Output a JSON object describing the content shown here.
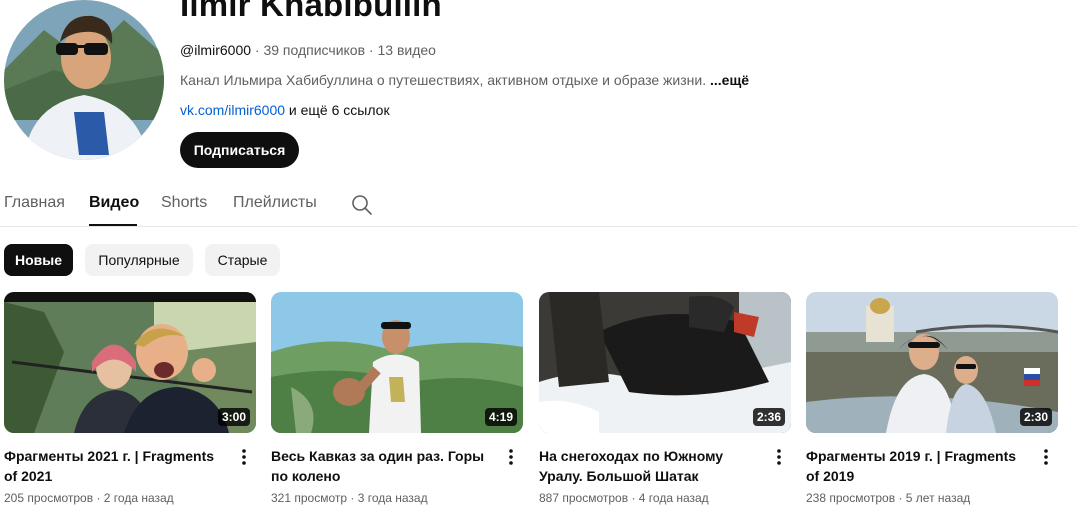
{
  "channel": {
    "name": "Ilmir Khabibullin",
    "handle": "@ilmir6000",
    "subscribers": "39 подписчиков",
    "video_count": "13 видео",
    "separator": "·",
    "description": "Канал Ильмира Хабибуллина о путешествиях, активном отдыхе и образе жизни.",
    "more_label": "...ещё",
    "link": "vk.com/ilmir6000",
    "more_links": "и ещё 6 ссылок",
    "subscribe_label": "Подписаться"
  },
  "tabs": [
    {
      "label": "Главная"
    },
    {
      "label": "Видео",
      "active": true
    },
    {
      "label": "Shorts"
    },
    {
      "label": "Плейлисты"
    }
  ],
  "search_icon": "search-icon",
  "filters": [
    {
      "label": "Новые",
      "active": true
    },
    {
      "label": "Популярные"
    },
    {
      "label": "Старые"
    }
  ],
  "videos": [
    {
      "title": "Фрагменты 2021 г. | Fragments of 2021",
      "duration": "3:00",
      "views": "205 просмотров",
      "age": "2 года назад"
    },
    {
      "title": "Весь Кавказ за один раз. Горы по колено",
      "duration": "4:19",
      "views": "321 просмотр",
      "age": "3 года назад"
    },
    {
      "title": "На снегоходах по Южному Уралу. Большой Шатак",
      "duration": "2:36",
      "views": "887 просмотров",
      "age": "4 года назад"
    },
    {
      "title": "Фрагменты 2019 г. | Fragments of 2019",
      "duration": "2:30",
      "views": "238 просмотров",
      "age": "5 лет назад"
    }
  ],
  "colors": {
    "accent": "#0f0f0f",
    "link": "#065fd4",
    "muted": "#606060",
    "chip_bg": "#f2f2f2"
  }
}
